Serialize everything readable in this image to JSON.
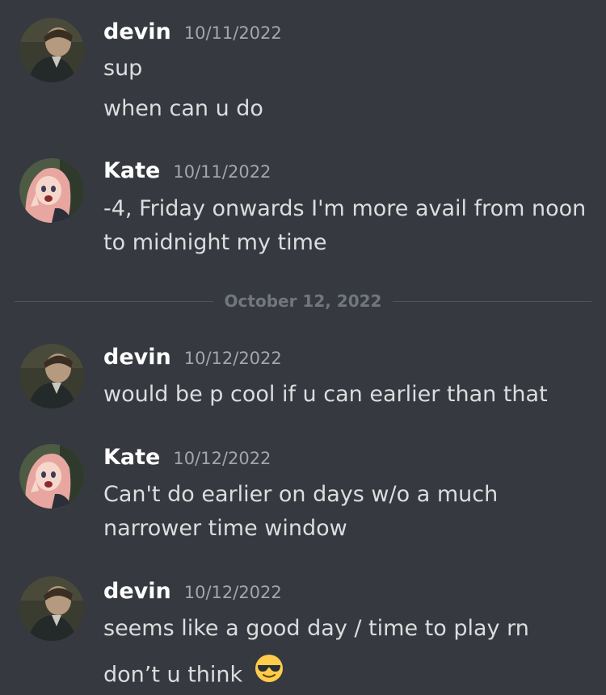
{
  "users": {
    "devin": {
      "name": "devin"
    },
    "kate": {
      "name": "Kate"
    }
  },
  "messages": [
    {
      "author": "devin",
      "timestamp": "10/11/2022",
      "lines": [
        "sup",
        "when can u do"
      ]
    },
    {
      "author": "Kate",
      "timestamp": "10/11/2022",
      "lines": [
        "-4, Friday onwards I'm more avail from noon",
        "to midnight my time"
      ]
    },
    {
      "author": "devin",
      "timestamp": "10/12/2022",
      "lines": [
        "would be p cool if u can earlier than that"
      ]
    },
    {
      "author": "Kate",
      "timestamp": "10/12/2022",
      "lines": [
        "Can't do earlier on days w/o a much",
        "narrower time window"
      ]
    },
    {
      "author": "devin",
      "timestamp": "10/12/2022",
      "lines": [
        "seems like a good day / time to play rn",
        "don’t u think"
      ],
      "emoji": "smiling-face-with-sunglasses-emoji"
    }
  ],
  "date_divider": {
    "label": "October 12, 2022"
  }
}
